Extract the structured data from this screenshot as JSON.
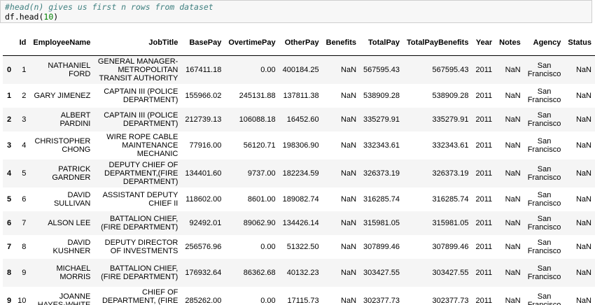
{
  "code": {
    "comment": "#head(n) gives us first n rows from dataset",
    "call_prefix": "df.head(",
    "call_arg": "10",
    "call_suffix": ")"
  },
  "table": {
    "columns": [
      "",
      "Id",
      "EmployeeName",
      "JobTitle",
      "BasePay",
      "OvertimePay",
      "OtherPay",
      "Benefits",
      "TotalPay",
      "TotalPayBenefits",
      "Year",
      "Notes",
      "Agency",
      "Status"
    ],
    "rows": [
      [
        "0",
        "1",
        "NATHANIEL FORD",
        "GENERAL MANAGER-METROPOLITAN TRANSIT AUTHORITY",
        "167411.18",
        "0.00",
        "400184.25",
        "NaN",
        "567595.43",
        "567595.43",
        "2011",
        "NaN",
        "San Francisco",
        "NaN"
      ],
      [
        "1",
        "2",
        "GARY JIMENEZ",
        "CAPTAIN III (POLICE DEPARTMENT)",
        "155966.02",
        "245131.88",
        "137811.38",
        "NaN",
        "538909.28",
        "538909.28",
        "2011",
        "NaN",
        "San Francisco",
        "NaN"
      ],
      [
        "2",
        "3",
        "ALBERT PARDINI",
        "CAPTAIN III (POLICE DEPARTMENT)",
        "212739.13",
        "106088.18",
        "16452.60",
        "NaN",
        "335279.91",
        "335279.91",
        "2011",
        "NaN",
        "San Francisco",
        "NaN"
      ],
      [
        "3",
        "4",
        "CHRISTOPHER CHONG",
        "WIRE ROPE CABLE MAINTENANCE MECHANIC",
        "77916.00",
        "56120.71",
        "198306.90",
        "NaN",
        "332343.61",
        "332343.61",
        "2011",
        "NaN",
        "San Francisco",
        "NaN"
      ],
      [
        "4",
        "5",
        "PATRICK GARDNER",
        "DEPUTY CHIEF OF DEPARTMENT,(FIRE DEPARTMENT)",
        "134401.60",
        "9737.00",
        "182234.59",
        "NaN",
        "326373.19",
        "326373.19",
        "2011",
        "NaN",
        "San Francisco",
        "NaN"
      ],
      [
        "5",
        "6",
        "DAVID SULLIVAN",
        "ASSISTANT DEPUTY CHIEF II",
        "118602.00",
        "8601.00",
        "189082.74",
        "NaN",
        "316285.74",
        "316285.74",
        "2011",
        "NaN",
        "San Francisco",
        "NaN"
      ],
      [
        "6",
        "7",
        "ALSON LEE",
        "BATTALION CHIEF, (FIRE DEPARTMENT)",
        "92492.01",
        "89062.90",
        "134426.14",
        "NaN",
        "315981.05",
        "315981.05",
        "2011",
        "NaN",
        "San Francisco",
        "NaN"
      ],
      [
        "7",
        "8",
        "DAVID KUSHNER",
        "DEPUTY DIRECTOR OF INVESTMENTS",
        "256576.96",
        "0.00",
        "51322.50",
        "NaN",
        "307899.46",
        "307899.46",
        "2011",
        "NaN",
        "San Francisco",
        "NaN"
      ],
      [
        "8",
        "9",
        "MICHAEL MORRIS",
        "BATTALION CHIEF, (FIRE DEPARTMENT)",
        "176932.64",
        "86362.68",
        "40132.23",
        "NaN",
        "303427.55",
        "303427.55",
        "2011",
        "NaN",
        "San Francisco",
        "NaN"
      ],
      [
        "9",
        "10",
        "JOANNE HAYES-WHITE",
        "CHIEF OF DEPARTMENT, (FIRE DEPARTMENT)",
        "285262.00",
        "0.00",
        "17115.73",
        "NaN",
        "302377.73",
        "302377.73",
        "2011",
        "NaN",
        "San Francisco",
        "NaN"
      ]
    ]
  }
}
